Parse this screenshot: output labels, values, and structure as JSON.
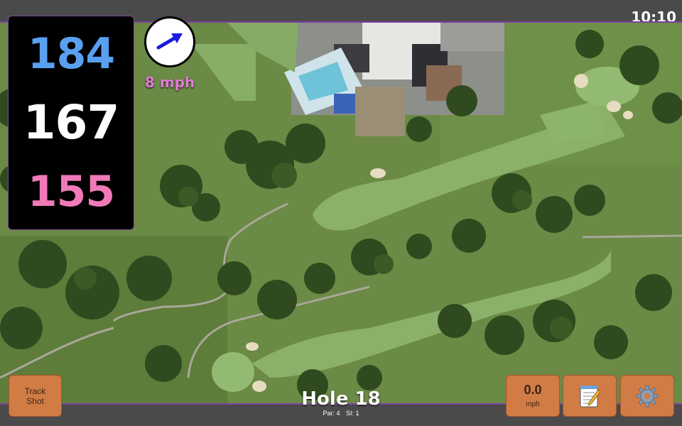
{
  "status": {
    "time": "10:10"
  },
  "distances": {
    "back": "184",
    "middle": "167",
    "front": "155"
  },
  "wind": {
    "speed_label": "8 mph",
    "icon": "wind-arrow-icon",
    "direction": "north-east"
  },
  "hole": {
    "title": "Hole 18",
    "par": "Par: 4",
    "si": "SI: 1"
  },
  "buttons": {
    "track_line1": "Track",
    "track_line2": "Shot",
    "speed_value": "0.0",
    "speed_unit": "mph",
    "notes_icon": "notepad-icon",
    "settings_icon": "gear-icon"
  },
  "colors": {
    "back_distance": "#5aa0f0",
    "middle_distance": "#ffffff",
    "front_distance": "#f07ab8",
    "wind_text": "#e07bd8",
    "button": "#d17b45",
    "map_border": "#7d3fa0"
  }
}
